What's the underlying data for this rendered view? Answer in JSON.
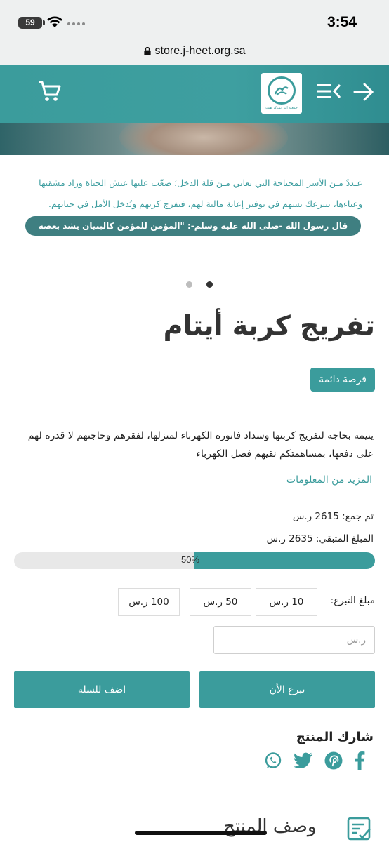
{
  "status_bar": {
    "time": "3:54",
    "battery": "59"
  },
  "browser": {
    "url": "store.j-heet.org.sa"
  },
  "header": {
    "logo_caption": "جمعية البر بمركز هيت"
  },
  "banner": {
    "text_line1": "عـددٌ مـن الأسر المحتاجة التي تعاني مـن قلة الدخل؛ صعّب عليها عيش الحياة وزاد مشقتها",
    "text_line2": "وعناءها، بتبرعك تسهم في توفير إعانة مالية لهم، فتفرج كربهم وتُدخل الأمل في حياتهم.",
    "hadith": "قال رسول الله -صلى الله عليه وسلم-: \"المؤمن للمؤمن كالبنيان يشد بعضه بعضاً\"."
  },
  "product": {
    "title": "تفريج كربة أيتام",
    "badge": "فرصة دائمة",
    "description": "يتيمة بحاجة لتفريج كربتها وسداد فاتورة الكهرباء لمنزلها، لفقرهم وحاجتهم لا قدرة لهم على دفعها، بمساهمتكم نقيهم فصل الكهرباء",
    "more_link": "المزيد من المعلومات",
    "collected": "تم جمع: 2615 ر.س",
    "remaining": "المبلغ المتبقي: 2635 ر.س",
    "progress_label": "50%",
    "progress_fraction": 0.5
  },
  "donation": {
    "amount_label": "مبلغ التبرع:",
    "amounts": [
      "10 ر.س",
      "50 ر.س",
      "100 ر.س"
    ],
    "custom_placeholder": "ر.س",
    "donate_now": "تبرع الأن",
    "add_to_cart": "اضف للسلة"
  },
  "share": {
    "title": "شارك المنتج",
    "icons": [
      "facebook-icon",
      "pinterest-icon",
      "twitter-icon",
      "whatsapp-icon"
    ]
  },
  "description_section": {
    "heading": "وصف المنتج"
  },
  "colors": {
    "accent": "#3b9c9c",
    "hadith_bg": "#3f7f81"
  }
}
